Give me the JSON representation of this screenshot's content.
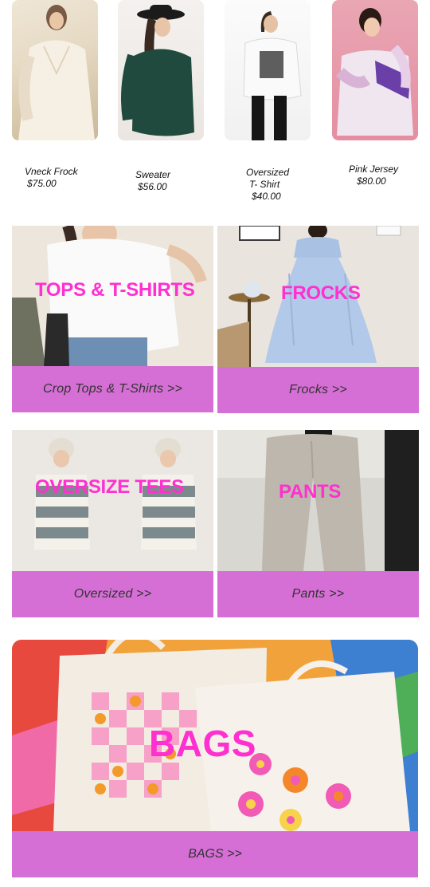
{
  "products": [
    {
      "name": "Vneck Frock",
      "price": "$75.00"
    },
    {
      "name": "Sweater",
      "price": "$56.00"
    },
    {
      "name_line1": "Oversized",
      "name_line2": "T- Shirt",
      "price": "$40.00"
    },
    {
      "name": "Pink Jersey",
      "price": "$80.00"
    }
  ],
  "categories": [
    {
      "overlay": "TOPS  & T-SHIRTS",
      "link": "Crop Tops & T-Shirts >>"
    },
    {
      "overlay": "FROCKS",
      "link": "Frocks >>"
    },
    {
      "overlay": "OVERSIZE TEES",
      "link": "Oversized >>"
    },
    {
      "overlay": "PANTS",
      "link": "Pants  >>"
    }
  ],
  "bags": {
    "overlay": "BAGS",
    "link": "BAGS >>"
  },
  "colors": {
    "accent_bar": "#d56fd5",
    "overlay_text": "#ff2fd0"
  }
}
